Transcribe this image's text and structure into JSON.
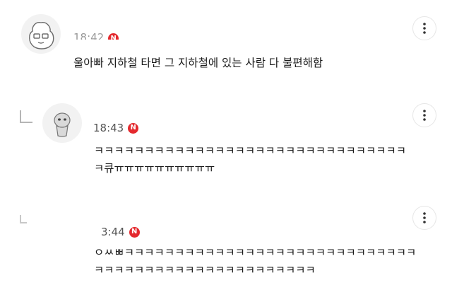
{
  "colors": {
    "badge": "#e4292e",
    "text": "#1a1a1a",
    "meta": "#555555"
  },
  "comments": [
    {
      "time": "18:42",
      "badge": "N",
      "text": "울아빠 지하철 타면 그 지하철에 있는 사람 다 불편해함"
    },
    {
      "time": "18:43",
      "badge": "N",
      "lines": [
        "ㅋㅋㅋㅋㅋㅋㅋㅋㅋㅋㅋㅋㅋㅋㅋㅋㅋㅋㅋㅋㅋㅋㅋㅋㅋㅋㅋㅋㅋㅋㅋ",
        "ㅋ큐ㅠㅠㅠㅠㅠㅠㅠㅠㅠㅠ"
      ]
    },
    {
      "time": "3:44",
      "badge": "N",
      "lines": [
        "ㅇㅆㅃㅋㅋㅋㅋㅋㅋㅋㅋㅋㅋㅋㅋㅋㅋㅋㅋㅋㅋㅋㅋㅋㅋㅋㅋㅋㅋㅋㅋㅋ",
        "ㅋㅋㅋㅋㅋㅋㅋㅋㅋㅋㅋㅋㅋㅋㅋㅋㅋㅋㅋㅋㅋㅋ"
      ]
    }
  ],
  "icons": {
    "more": "more-vertical-icon",
    "reply": "reply-arrow-icon",
    "badge": "new-badge"
  }
}
